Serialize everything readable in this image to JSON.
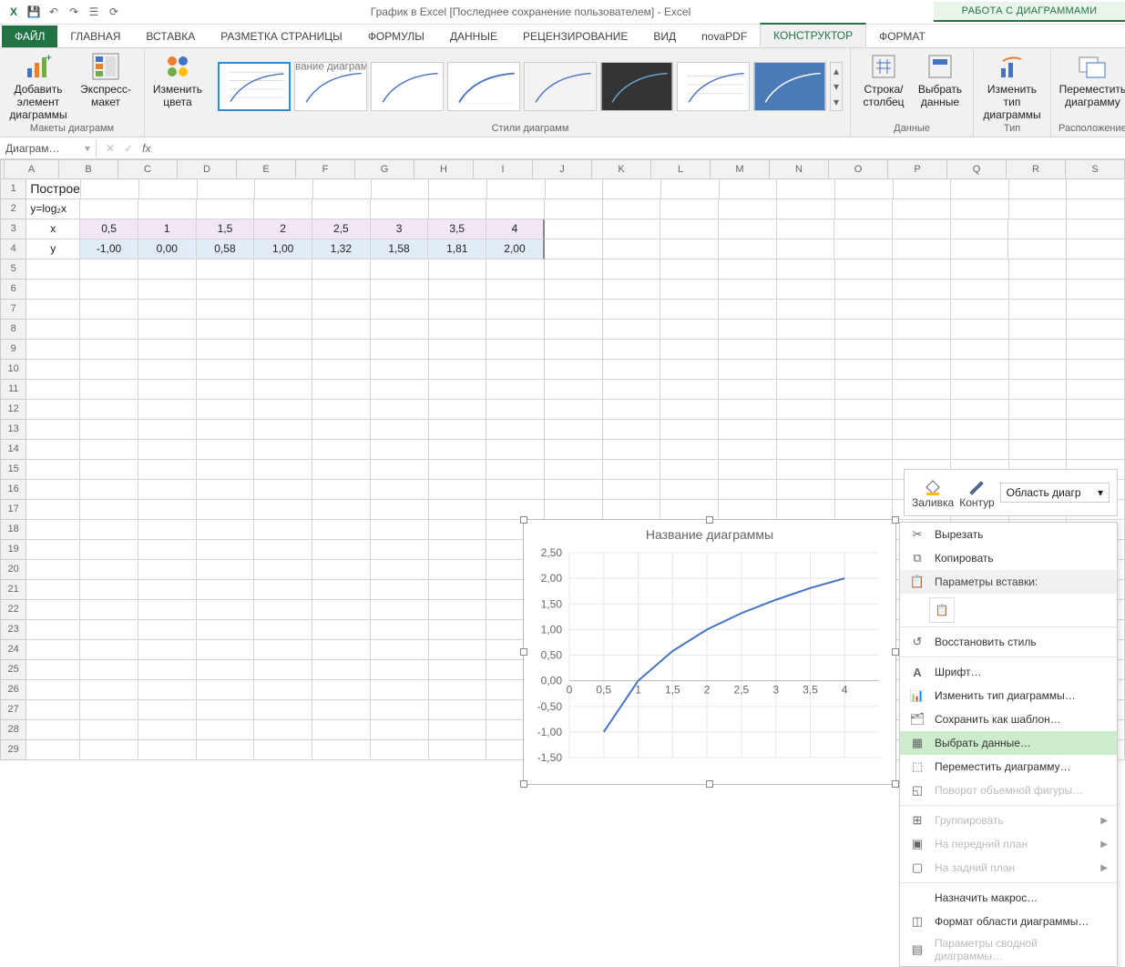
{
  "app": {
    "title": "График в Excel [Последнее сохранение пользователем] - Excel",
    "chart_tools_header": "РАБОТА С ДИАГРАММАМИ"
  },
  "tabs": {
    "file": "ФАЙЛ",
    "home": "ГЛАВНАЯ",
    "insert": "ВСТАВКА",
    "page_layout": "РАЗМЕТКА СТРАНИЦЫ",
    "formulas": "ФОРМУЛЫ",
    "data": "ДАННЫЕ",
    "review": "РЕЦЕНЗИРОВАНИЕ",
    "view": "ВИД",
    "novapdf": "novaPDF",
    "design": "КОНСТРУКТОР",
    "format": "ФОРМАТ"
  },
  "ribbon": {
    "add_element": "Добавить элемент диаграммы",
    "quick_layout": "Экспресс-макет",
    "change_colors": "Изменить цвета",
    "switch_rowcol": "Строка/столбец",
    "select_data": "Выбрать данные",
    "change_type": "Изменить тип диаграммы",
    "move_chart": "Переместить диаграмму",
    "grp_layouts": "Макеты диаграмм",
    "grp_styles": "Стили диаграмм",
    "grp_data": "Данные",
    "grp_type": "Тип",
    "grp_location": "Расположение"
  },
  "namebox": "Диаграм…",
  "sheet": {
    "title_text": "Построение графика логарифмической функции",
    "formula_text": "y=log₂x",
    "x_label": "x",
    "y_label": "y",
    "cols": [
      "A",
      "B",
      "C",
      "D",
      "E",
      "F",
      "G",
      "H",
      "I",
      "J",
      "K",
      "L",
      "M",
      "N",
      "O",
      "P",
      "Q",
      "R",
      "S"
    ],
    "x_vals": [
      "0,5",
      "1",
      "1,5",
      "2",
      "2,5",
      "3",
      "3,5",
      "4"
    ],
    "y_vals": [
      "-1,00",
      "0,00",
      "0,58",
      "1,00",
      "1,32",
      "1,58",
      "1,81",
      "2,00"
    ]
  },
  "mini_toolbar": {
    "fill": "Заливка",
    "outline": "Контур",
    "selector": "Область диагр"
  },
  "context_menu": {
    "cut": "Вырезать",
    "copy": "Копировать",
    "paste_options": "Параметры вставки:",
    "reset_style": "Восстановить стиль",
    "font": "Шрифт…",
    "change_type": "Изменить тип диаграммы…",
    "save_template": "Сохранить как шаблон…",
    "select_data": "Выбрать данные…",
    "move_chart": "Переместить диаграмму…",
    "rotate_3d": "Поворот объемной фигуры…",
    "group": "Группировать",
    "bring_front": "На передний план",
    "send_back": "На задний план",
    "assign_macro": "Назначить макрос…",
    "format_area": "Формат области диаграммы…",
    "pivot_options": "Параметры сводной диаграммы…"
  },
  "chart": {
    "title": "Название диаграммы"
  },
  "chart_data": {
    "type": "line",
    "title": "Название диаграммы",
    "xlabel": "",
    "ylabel": "",
    "x": [
      0.5,
      1,
      1.5,
      2,
      2.5,
      3,
      3.5,
      4
    ],
    "series": [
      {
        "name": "y",
        "values": [
          -1.0,
          0.0,
          0.58,
          1.0,
          1.32,
          1.58,
          1.81,
          2.0
        ]
      }
    ],
    "x_ticks": [
      0,
      0.5,
      1,
      1.5,
      2,
      2.5,
      3,
      3.5,
      4
    ],
    "y_ticks": [
      -1.5,
      -1.0,
      -0.5,
      0.0,
      0.5,
      1.0,
      1.5,
      2.0,
      2.5
    ],
    "ylim": [
      -1.5,
      2.5
    ],
    "xlim": [
      0,
      4.5
    ]
  }
}
